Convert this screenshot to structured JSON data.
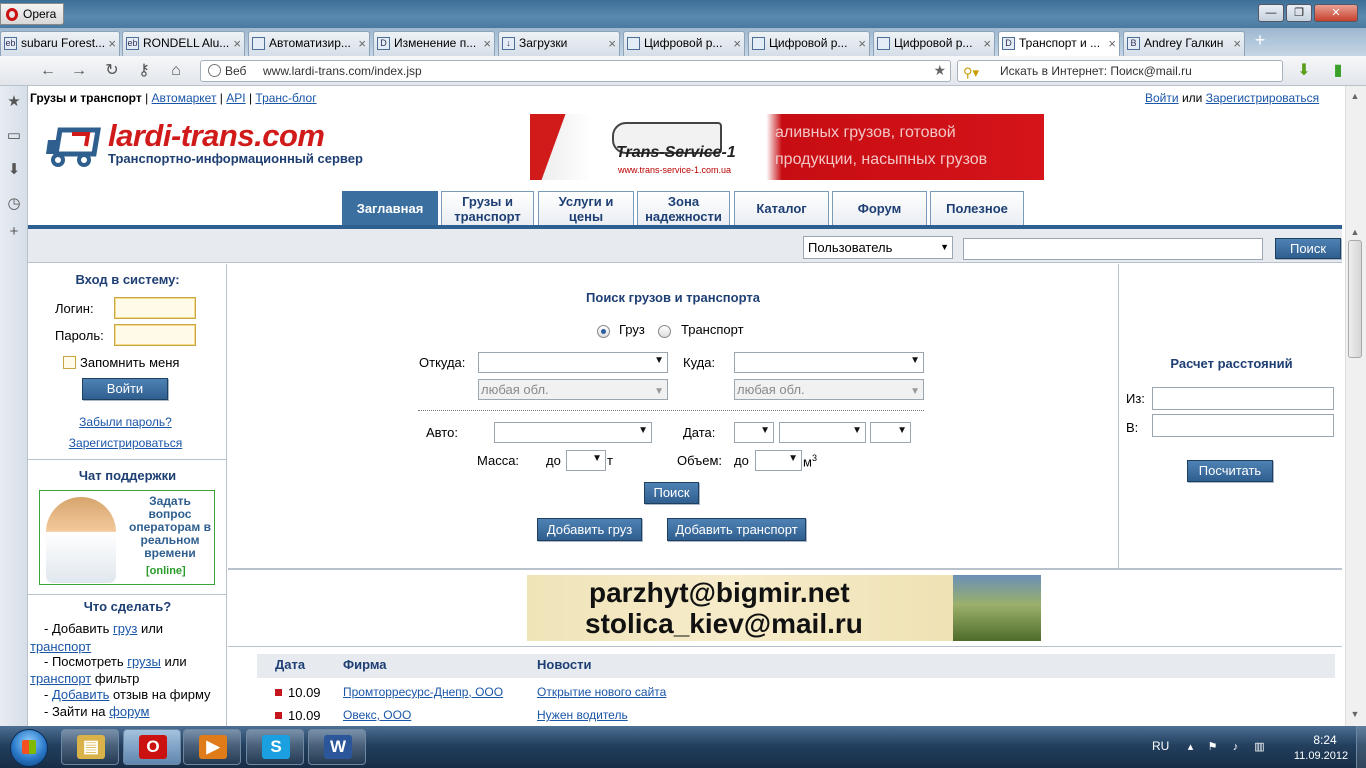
{
  "window": {
    "app_name": "Opera",
    "minimize": "—",
    "restore": "❐",
    "close": "✕"
  },
  "tabs": [
    {
      "icon": "ebay-icon",
      "fav": "eb",
      "label": "subaru Forest..."
    },
    {
      "icon": "ebay-icon",
      "fav": "eb",
      "label": "RONDELL Alu..."
    },
    {
      "icon": "avatar-icon",
      "fav": "",
      "label": "Автоматизир..."
    },
    {
      "icon": "d-icon",
      "fav": "D",
      "label": "Изменение п..."
    },
    {
      "icon": "download-icon",
      "fav": "↓",
      "label": "Загрузки"
    },
    {
      "icon": "document-icon",
      "fav": "",
      "label": "Цифровой р..."
    },
    {
      "icon": "document-icon",
      "fav": "",
      "label": "Цифровой р..."
    },
    {
      "icon": "document-icon",
      "fav": "",
      "label": "Цифровой р..."
    },
    {
      "icon": "lardi-icon",
      "fav": "D",
      "label": "Транспорт и ..."
    },
    {
      "icon": "vk-icon",
      "fav": "B",
      "label": "Andrey Галкин"
    }
  ],
  "tab_close": "×",
  "new_tab": "+",
  "nav": {
    "back_icon": "←",
    "forward_icon": "→",
    "reload_icon": "↻",
    "key_icon": "⚷",
    "home_icon": "⌂",
    "web_label": "Веб",
    "url": "www.lardi-trans.com/index.jsp",
    "star_icon": "★",
    "search_placeholder": "Искать в Интернет: Поиск@mail.ru",
    "download_icon": "⬇",
    "signal_icon": "▮"
  },
  "side_panel": [
    "★",
    "▭",
    "⬇",
    "◷",
    "+"
  ],
  "site": {
    "topline": {
      "brand": "Грузы и транспорт",
      "sep": "|",
      "links": [
        "Автомаркет",
        "API",
        "Транс-блог"
      ]
    },
    "auth": {
      "login": "Войти",
      "or": "или",
      "register": "Зарегистрироваться"
    },
    "logo": {
      "name": "lardi-trans.com",
      "subtitle": "Транспортно-информационный сервер"
    },
    "banner": {
      "brand": "Trans-Service-1",
      "site": "www.trans-service-1.com.ua",
      "line1": "аливных грузов, готовой",
      "line2": "продукции, насыпных грузов"
    },
    "menu": [
      "Заглавная",
      "Грузы и транспорт",
      "Услуги и цены",
      "Зона надежности",
      "Каталог",
      "Форум",
      "Полезное"
    ],
    "menu_lines": [
      [
        "Заглавная"
      ],
      [
        "Грузы и",
        "транспорт"
      ],
      [
        "Услуги и",
        "цены"
      ],
      [
        "Зона",
        "надежности"
      ],
      [
        "Каталог"
      ],
      [
        "Форум"
      ],
      [
        "Полезное"
      ]
    ],
    "user_search": {
      "select_value": "Пользователь",
      "button": "Поиск"
    },
    "login_box": {
      "title": "Вход в систему:",
      "login_label": "Логин:",
      "password_label": "Пароль:",
      "remember": "Запомнить меня",
      "submit": "Войти",
      "forgot": "Забыли пароль?",
      "register": "Зарегистрироваться"
    },
    "support": {
      "title": "Чат поддержки",
      "text": "Задать вопрос операторам в реальном времени",
      "status": "[online]"
    },
    "todo": {
      "title": "Что сделать?",
      "line1_a": "- Добавить",
      "line1_link1": "груз",
      "line1_b": "или",
      "line1_link2": "транспорт",
      "line2_a": "- Посмотреть",
      "line2_link1": "грузы",
      "line2_b": "или",
      "line2_link2": "транспорт",
      "line2_c": "фильтр",
      "line3_a": "-",
      "line3_link": "Добавить",
      "line3_b": "отзыв на фирму",
      "line4_a": "- Зайти на",
      "line4_link": "форум"
    },
    "cargo_search": {
      "title": "Поиск грузов и транспорта",
      "radio_cargo": "Груз",
      "radio_transport": "Транспорт",
      "from_label": "Откуда:",
      "to_label": "Куда:",
      "region_placeholder": "любая обл.",
      "auto_label": "Авто:",
      "date_label": "Дата:",
      "mass_label": "Масса:",
      "mass_to": "до",
      "mass_unit": "т",
      "volume_label": "Объем:",
      "volume_to": "до",
      "volume_unit": "м",
      "volume_sup": "3",
      "search_button": "Поиск",
      "add_cargo": "Добавить груз",
      "add_transport": "Добавить транспорт"
    },
    "distance": {
      "title": "Расчет расстояний",
      "from": "Из:",
      "to": "В:",
      "button": "Посчитать"
    },
    "ad": {
      "line1": "parzhyt@bigmir.net",
      "line2": "stolica_kiev@mail.ru"
    },
    "news": {
      "headers": [
        "Дата",
        "Фирма",
        "Новости"
      ],
      "rows": [
        {
          "date": "10.09",
          "firm": "Промторресурс-Днепр, ООО",
          "news": "Открытие нового сайта"
        },
        {
          "date": "10.09",
          "firm": "Овекс, ООО",
          "news": "Нужен водитель"
        }
      ]
    }
  },
  "taskbar": {
    "apps": [
      {
        "name": "explorer",
        "glyph": "▤",
        "color": "#d9b34a"
      },
      {
        "name": "opera",
        "glyph": "O",
        "color": "#cc1111"
      },
      {
        "name": "media-player",
        "glyph": "▶",
        "color": "#e07b1a"
      },
      {
        "name": "skype",
        "glyph": "S",
        "color": "#1aa0e0"
      },
      {
        "name": "word",
        "glyph": "W",
        "color": "#2b579a"
      }
    ],
    "lang": "RU",
    "time": "8:24",
    "date": "11.09.2012"
  }
}
